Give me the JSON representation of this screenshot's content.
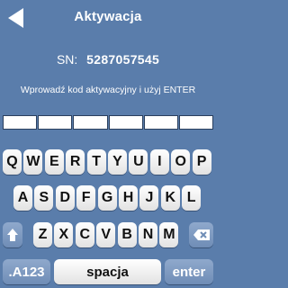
{
  "header": {
    "title": "Aktywacja",
    "back_icon": "back-arrow-icon"
  },
  "serial": {
    "label": "SN:",
    "value": "5287057545"
  },
  "instruction": "Wprowadź kod aktywacyjny i użyj ENTER",
  "code_fields": [
    "",
    "",
    "",
    "",
    "",
    ""
  ],
  "keyboard": {
    "row1": [
      "Q",
      "W",
      "E",
      "R",
      "T",
      "Y",
      "U",
      "I",
      "O",
      "P"
    ],
    "row2": [
      "A",
      "S",
      "D",
      "F",
      "G",
      "H",
      "J",
      "K",
      "L"
    ],
    "row3": [
      "Z",
      "X",
      "C",
      "V",
      "B",
      "N",
      "M"
    ],
    "shift_icon": "shift-up-arrow-icon",
    "backspace_icon": "backspace-icon",
    "mode_label": ".A123",
    "space_label": "spacja",
    "enter_label": "enter"
  },
  "colors": {
    "background": "#5a7dab",
    "key": "#ffffff",
    "func_key": "#7f9bc2"
  }
}
